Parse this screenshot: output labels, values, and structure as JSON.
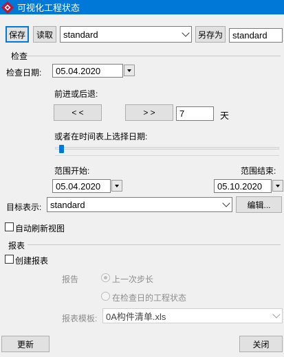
{
  "window": {
    "title": "可视化工程状态"
  },
  "toolbar": {
    "save_label": "保存",
    "load_label": "读取",
    "preset_value": "standard",
    "save_as_label": "另存为",
    "save_as_name": "standard"
  },
  "check": {
    "section_label": "检查",
    "date_label": "检查日期:",
    "date_value": "05.04.2020",
    "step_label": "前进或后退:",
    "back_label": "< <",
    "forward_label": "> >",
    "step_days": "7",
    "days_unit": "天",
    "timeline_label": "或者在时间表上选择日期:",
    "timeline_position": 0.02,
    "range_start_label": "范围开始:",
    "range_start_value": "05.04.2020",
    "range_end_label": "范围结束:",
    "range_end_value": "05.10.2020",
    "target_label": "目标表示:",
    "target_value": "standard",
    "edit_label": "编辑...",
    "auto_refresh_label": "自动刷新视图",
    "auto_refresh_checked": false
  },
  "report": {
    "section_label": "报表",
    "create_label": "创建报表",
    "create_checked": false,
    "report_label": "报告",
    "option_last_step": "上一次步长",
    "option_status_at_date": "在检查日的工程状态",
    "template_label": "报表模板:",
    "template_value": "0A构件清单.xls"
  },
  "footer": {
    "refresh_label": "更新",
    "close_label": "关闭"
  }
}
